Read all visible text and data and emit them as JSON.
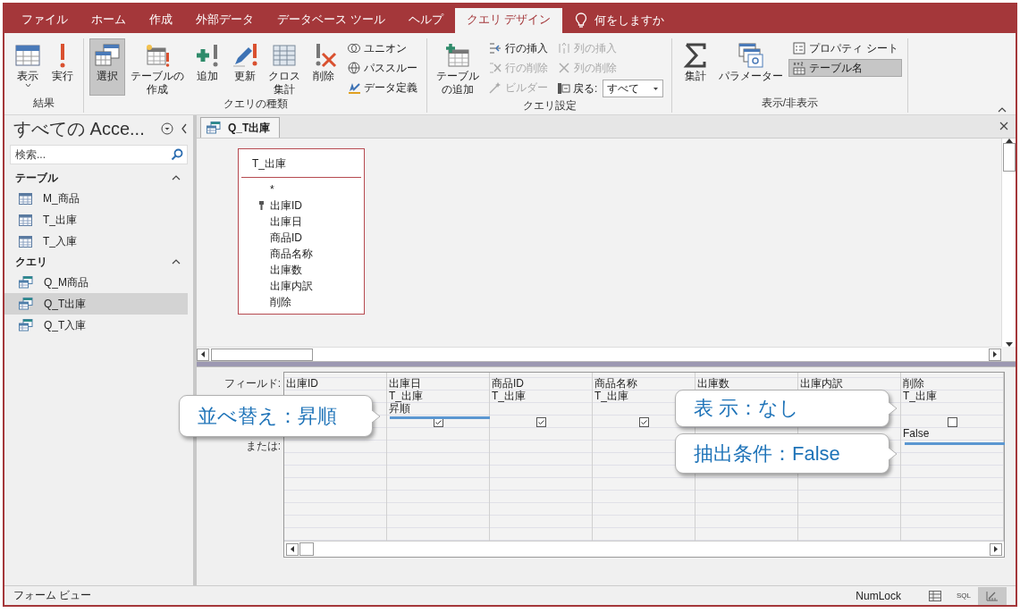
{
  "ribbon_tabs": [
    {
      "label": "ファイル",
      "selected": false
    },
    {
      "label": "ホーム",
      "selected": false
    },
    {
      "label": "作成",
      "selected": false
    },
    {
      "label": "外部データ",
      "selected": false
    },
    {
      "label": "データベース ツール",
      "selected": false
    },
    {
      "label": "ヘルプ",
      "selected": false
    },
    {
      "label": "クエリ デザイン",
      "selected": true
    }
  ],
  "tell_me": "何をしますか",
  "ribbon_groups": [
    {
      "label": "結果",
      "items": [
        {
          "kind": "large",
          "label": "表示",
          "dropdown": true,
          "pressed": false
        },
        {
          "kind": "large",
          "label": "実行",
          "pressed": false
        }
      ]
    },
    {
      "label": "クエリの種類",
      "items": [
        {
          "kind": "large",
          "label": "選択",
          "pressed": true
        },
        {
          "kind": "large",
          "label": "テーブルの作成",
          "pressed": false
        },
        {
          "kind": "large",
          "label": "追加",
          "pressed": false
        },
        {
          "kind": "large",
          "label": "更新",
          "pressed": false
        },
        {
          "kind": "large",
          "label": "クロス集計",
          "pressed": false
        },
        {
          "kind": "large",
          "label": "削除",
          "pressed": false
        },
        {
          "kind": "stack",
          "items": [
            {
              "kind": "small",
              "label": "ユニオン",
              "disabled": false,
              "pressed": false
            },
            {
              "kind": "small",
              "label": "パススルー",
              "disabled": false,
              "pressed": false
            },
            {
              "kind": "small",
              "label": "データ定義",
              "disabled": false,
              "pressed": false
            }
          ]
        }
      ]
    },
    {
      "label": "クエリ設定",
      "items": [
        {
          "kind": "large",
          "label": "テーブルの追加",
          "pressed": false
        },
        {
          "kind": "stack",
          "items": [
            {
              "kind": "small",
              "label": "行の挿入",
              "disabled": false,
              "pressed": false
            },
            {
              "kind": "small",
              "label": "行の削除",
              "disabled": true,
              "pressed": false
            },
            {
              "kind": "small",
              "label": "ビルダー",
              "disabled": true,
              "pressed": false
            }
          ]
        },
        {
          "kind": "stack",
          "items": [
            {
              "kind": "small",
              "label": "列の挿入",
              "disabled": true,
              "pressed": false
            },
            {
              "kind": "small",
              "label": "列の削除",
              "disabled": true,
              "pressed": false
            },
            {
              "kind": "combo",
              "label": "戻る:",
              "value": "すべて"
            }
          ]
        }
      ]
    },
    {
      "label": "表示/非表示",
      "items": [
        {
          "kind": "large",
          "label": "集計",
          "pressed": false
        },
        {
          "kind": "large",
          "label": "パラメーター",
          "pressed": false
        },
        {
          "kind": "stack",
          "items": [
            {
              "kind": "small",
              "label": "プロパティ シート",
              "disabled": false,
              "pressed": false
            },
            {
              "kind": "small",
              "label": "テーブル名",
              "disabled": false,
              "pressed": true
            }
          ]
        }
      ]
    }
  ],
  "nav": {
    "title": "すべての Acce...",
    "search_placeholder": "検索...",
    "groups": [
      {
        "label": "テーブル",
        "kind": "table",
        "expanded": true,
        "items": [
          {
            "label": "M_商品",
            "selected": false
          },
          {
            "label": "T_出庫",
            "selected": false
          },
          {
            "label": "T_入庫",
            "selected": false
          }
        ]
      },
      {
        "label": "クエリ",
        "kind": "query",
        "expanded": true,
        "items": [
          {
            "label": "Q_M商品",
            "selected": false
          },
          {
            "label": "Q_T出庫",
            "selected": true
          },
          {
            "label": "Q_T入庫",
            "selected": false
          }
        ]
      }
    ]
  },
  "document_tabs": [
    {
      "label": "Q_T出庫",
      "selected": true
    }
  ],
  "table_box": {
    "title": "T_出庫",
    "fields": [
      {
        "name": "*",
        "key": false
      },
      {
        "name": "出庫ID",
        "key": true
      },
      {
        "name": "出庫日",
        "key": false
      },
      {
        "name": "商品ID",
        "key": false
      },
      {
        "name": "商品名称",
        "key": false
      },
      {
        "name": "出庫数",
        "key": false
      },
      {
        "name": "出庫内訳",
        "key": false
      },
      {
        "name": "削除",
        "key": false
      }
    ]
  },
  "design_grid": {
    "row_labels": [
      {
        "kind": "field",
        "text": "フィールド:"
      },
      {
        "kind": "or",
        "text": "または:"
      }
    ],
    "columns": [
      {
        "field": "出庫ID"
      },
      {
        "field": "出庫日",
        "table": "T_出庫",
        "sort": "昇順",
        "show": true
      },
      {
        "field": "商品ID",
        "table": "T_出庫",
        "show": true
      },
      {
        "field": "商品名称",
        "table": "T_出庫",
        "show": true
      },
      {
        "field": "出庫数"
      },
      {
        "field": "出庫内訳"
      },
      {
        "field": "削除",
        "table": "T_出庫",
        "show": false,
        "criteria": "False"
      }
    ]
  },
  "callouts": [
    {
      "text": "並べ替え：昇順"
    },
    {
      "text": "表 示：なし"
    },
    {
      "text": "抽出条件：False"
    }
  ],
  "status_bar": {
    "text": "フォーム ビュー",
    "num_lock": "NumLock",
    "views": [
      {
        "kind": "datasheet",
        "selected": false
      },
      {
        "kind": "sql",
        "label": "SQL",
        "selected": false
      },
      {
        "kind": "design",
        "selected": true
      }
    ]
  }
}
